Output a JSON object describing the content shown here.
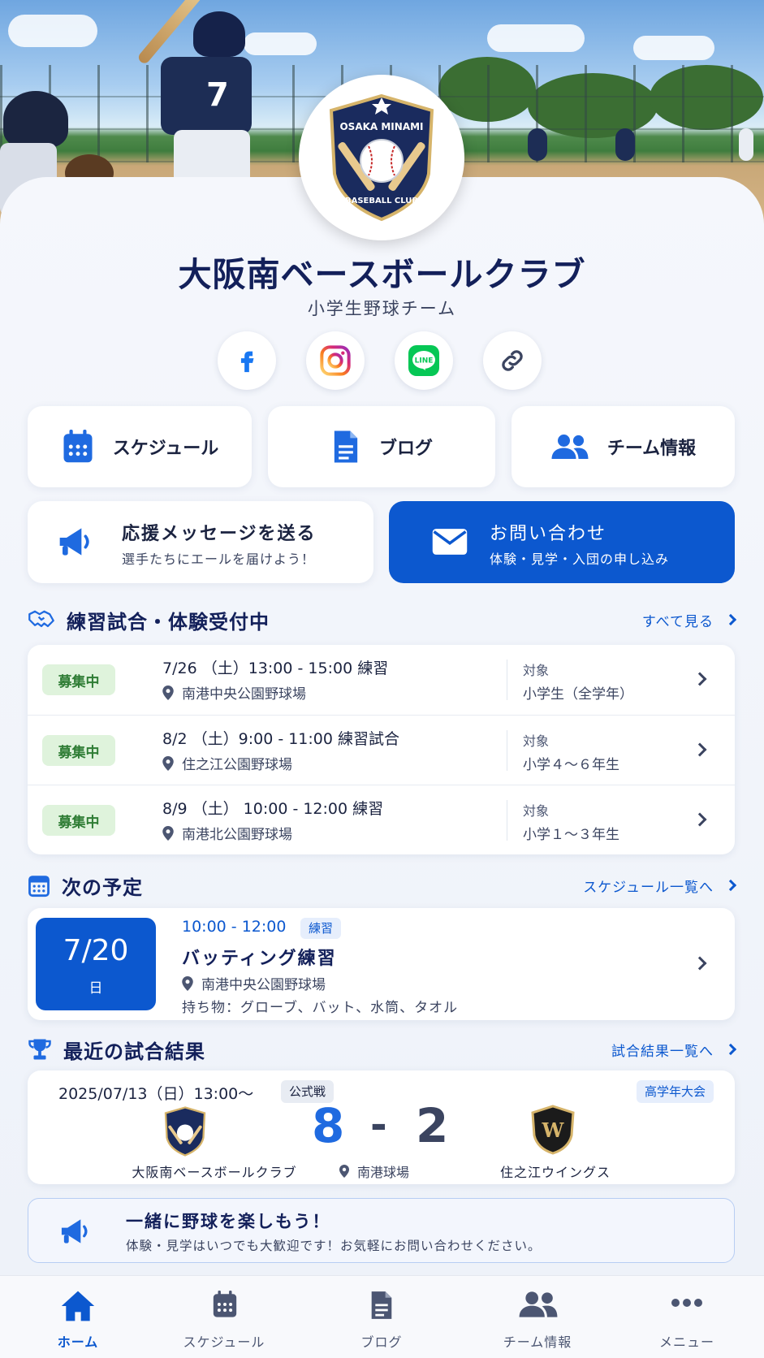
{
  "team": {
    "logo": {
      "top_text": "OSAKA MINAMI",
      "bottom_text": "BASEBALL CLUB"
    },
    "name": "大阪南ベースボールクラブ",
    "subtitle": "小学生野球チーム"
  },
  "hero": {
    "jersey_number": "7"
  },
  "social": [
    {
      "name": "facebook-icon"
    },
    {
      "name": "instagram-icon"
    },
    {
      "name": "line-icon",
      "label": "LINE"
    },
    {
      "name": "link-icon"
    }
  ],
  "quick_nav": {
    "schedule": "スケジュール",
    "blog": "ブログ",
    "team_info": "チーム情報"
  },
  "cheer": {
    "title": "応援メッセージを送る",
    "subtitle": "選手たちにエールを届けよう！"
  },
  "contact": {
    "title": "お問い合わせ",
    "subtitle": "体験・見学・入団の申し込み"
  },
  "recruiting": {
    "title": "練習試合・体験受付中",
    "link": "すべて見る",
    "events": [
      {
        "badge": "募集中",
        "datetime": "7/26 （土）13:00 - 15:00  練習",
        "place": "南港中央公園野球場",
        "target_label": "対象",
        "target": "小学生（全学年）"
      },
      {
        "badge": "募集中",
        "datetime": "8/2 （土）9:00 - 11:00  練習試合",
        "place": "住之江公園野球場",
        "target_label": "対象",
        "target": "小学４〜６年生"
      },
      {
        "badge": "募集中",
        "datetime": "8/9 （土） 10:00 - 12:00  練習",
        "place": "南港北公園野球場",
        "target_label": "対象",
        "target": "小学１〜３年生"
      }
    ]
  },
  "next": {
    "title": "次の予定",
    "link": "スケジュール一覧へ",
    "date": "7/20",
    "weekday": "日",
    "time": "10:00 - 12:00",
    "tag": "練習",
    "name": "バッティング練習",
    "place": "南港中央公園野球場",
    "items": "持ち物：グローブ、バット、水筒、タオル"
  },
  "results": {
    "title": "最近の試合結果",
    "link": "試合結果一覧へ",
    "datetime": "2025/07/13（日）13:00〜",
    "type_badge": "公式戦",
    "tournament": "高学年大会",
    "home_team": "大阪南ベースボールクラブ",
    "home_score": "8",
    "separator": "-",
    "away_score": "2",
    "away_team": "住之江ウイングス",
    "away_logo_letter": "W",
    "venue": "南港球場"
  },
  "banner": {
    "title": "一緒に野球を楽しもう！",
    "text": "体験・見学はいつでも大歓迎です！お気軽にお問い合わせください。"
  },
  "bottom_nav": [
    {
      "label": "ホーム",
      "active": true
    },
    {
      "label": "スケジュール"
    },
    {
      "label": "ブログ"
    },
    {
      "label": "チーム情報"
    },
    {
      "label": "メニュー"
    }
  ],
  "colors": {
    "primary": "#0c58cf",
    "navy": "#13205a",
    "green_badge": "#dff3dc"
  }
}
